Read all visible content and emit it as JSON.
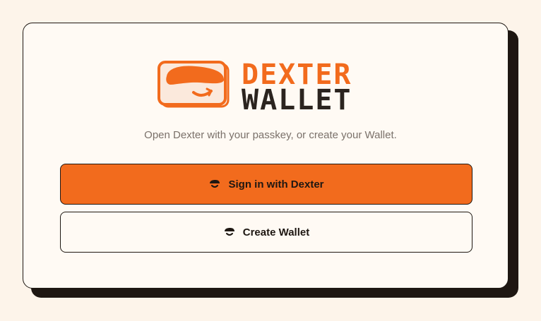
{
  "brand": {
    "line1": "DEXTER",
    "line2": "WALLET",
    "icon": "dexter-mascot-icon",
    "accent_color": "#f26b1d",
    "dark_color": "#2b241f"
  },
  "tagline": "Open Dexter with your passkey, or create your Wallet.",
  "actions": {
    "sign_in": {
      "label": "Sign in with Dexter",
      "icon": "dexter-face-icon"
    },
    "create": {
      "label": "Create Wallet",
      "icon": "dexter-face-icon"
    }
  }
}
